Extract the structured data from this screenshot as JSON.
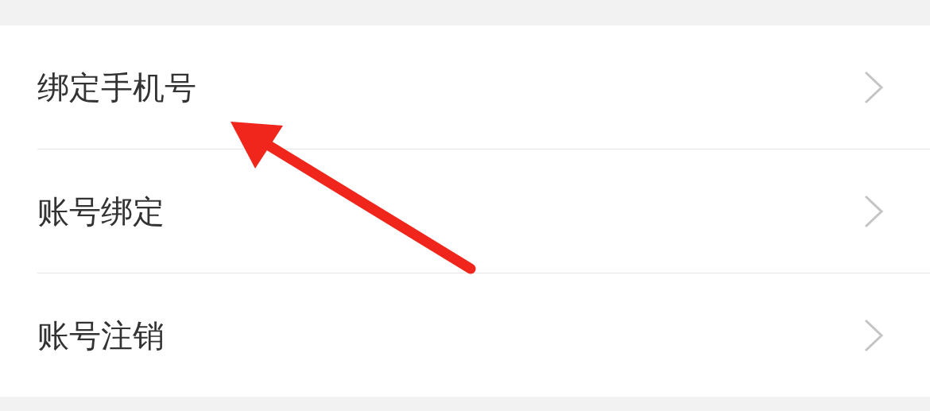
{
  "items": [
    {
      "label": "绑定手机号"
    },
    {
      "label": "账号绑定"
    },
    {
      "label": "账号注销"
    }
  ]
}
